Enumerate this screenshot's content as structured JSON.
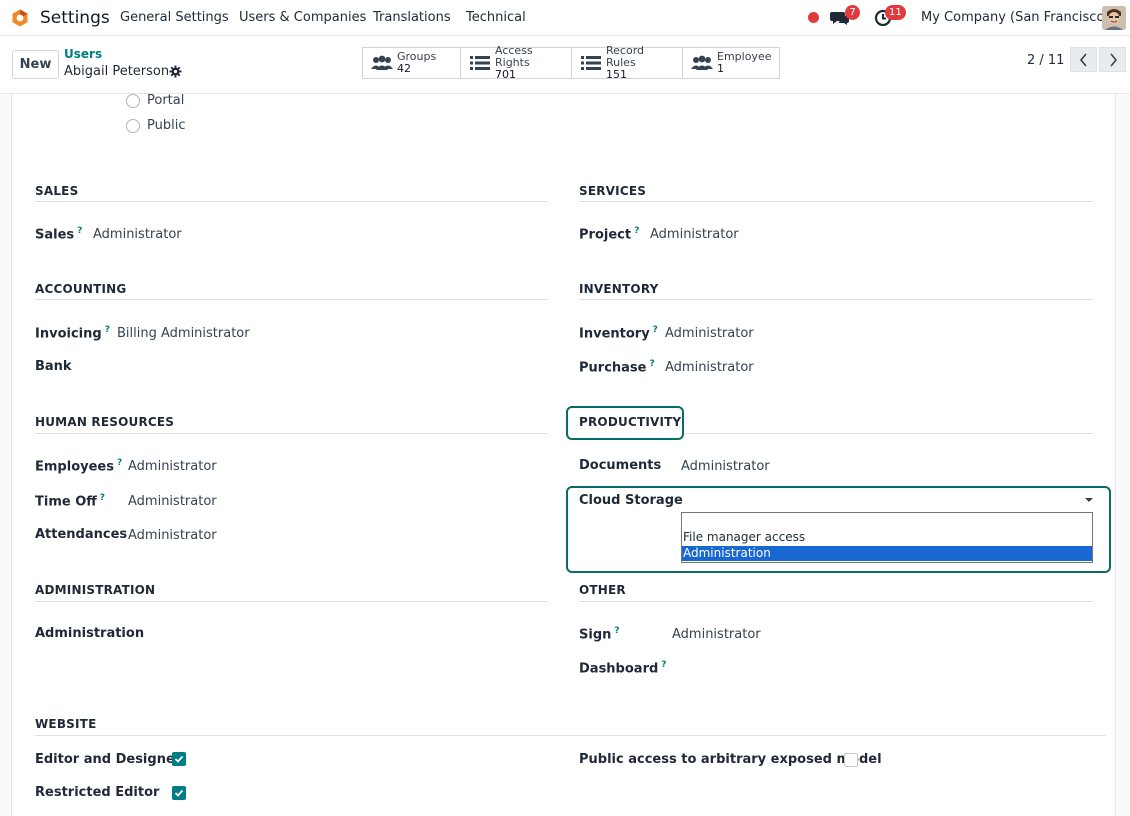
{
  "navbar": {
    "app_name": "Settings",
    "menu": [
      "General Settings",
      "Users & Companies",
      "Translations",
      "Technical"
    ],
    "chat_count": "7",
    "activity_count": "11",
    "company": "My Company (San Francisco)"
  },
  "control": {
    "new_label": "New",
    "breadcrumb_parent": "Users",
    "breadcrumb_current": "Abigail Peterson",
    "smart_buttons": [
      {
        "label": "Groups",
        "value": "42",
        "icon": "users-icon"
      },
      {
        "label": "Access Rights",
        "value": "701",
        "icon": "list-icon"
      },
      {
        "label": "Record Rules",
        "value": "151",
        "icon": "list-icon"
      },
      {
        "label": "Employee",
        "value": "1",
        "icon": "users-icon"
      }
    ],
    "pager": "2 / 11"
  },
  "user_type": {
    "options": [
      "Portal",
      "Public"
    ]
  },
  "sections": {
    "sales": {
      "title": "SALES",
      "fields": [
        {
          "label": "Sales",
          "help": "?",
          "value": "Administrator"
        }
      ]
    },
    "services": {
      "title": "SERVICES",
      "fields": [
        {
          "label": "Project",
          "help": "?",
          "value": "Administrator"
        }
      ]
    },
    "accounting": {
      "title": "ACCOUNTING",
      "fields": [
        {
          "label": "Invoicing",
          "help": "?",
          "value": "Billing Administrator"
        },
        {
          "label": "Bank",
          "value": ""
        }
      ]
    },
    "inventory": {
      "title": "INVENTORY",
      "fields": [
        {
          "label": "Inventory",
          "help": "?",
          "value": "Administrator"
        },
        {
          "label": "Purchase",
          "help": "?",
          "value": "Administrator"
        }
      ]
    },
    "human_resources": {
      "title": "HUMAN RESOURCES",
      "fields": [
        {
          "label": "Employees",
          "help": "?",
          "value": "Administrator"
        },
        {
          "label": "Time Off",
          "help": "?",
          "value": "Administrator"
        },
        {
          "label": "Attendances",
          "value": "Administrator"
        }
      ]
    },
    "productivity": {
      "title": "PRODUCTIVITY",
      "fields": [
        {
          "label": "Documents",
          "value": "Administrator"
        },
        {
          "label": "Cloud Storage",
          "value": ""
        }
      ]
    },
    "administration": {
      "title": "ADMINISTRATION",
      "fields": [
        {
          "label": "Administration",
          "value": ""
        }
      ]
    },
    "other": {
      "title": "OTHER",
      "fields": [
        {
          "label": "Sign",
          "help": "?",
          "value": "Administrator"
        },
        {
          "label": "Dashboard",
          "help": "?",
          "value": ""
        }
      ]
    },
    "website": {
      "title": "WEBSITE",
      "fields": [
        {
          "label": "Editor and Designer",
          "checked": true
        },
        {
          "label": "Restricted Editor",
          "checked": true
        },
        {
          "label": "Public access to arbitrary exposed model",
          "checked": false
        }
      ]
    }
  },
  "cloud_storage_dropdown": {
    "options": [
      "",
      "File manager access",
      "Administration"
    ],
    "selected": "Administration"
  },
  "colors": {
    "accent": "#017e84",
    "badge": "#e03a3e",
    "focus": "#0b6b66",
    "selected_option": "#1967d2"
  }
}
